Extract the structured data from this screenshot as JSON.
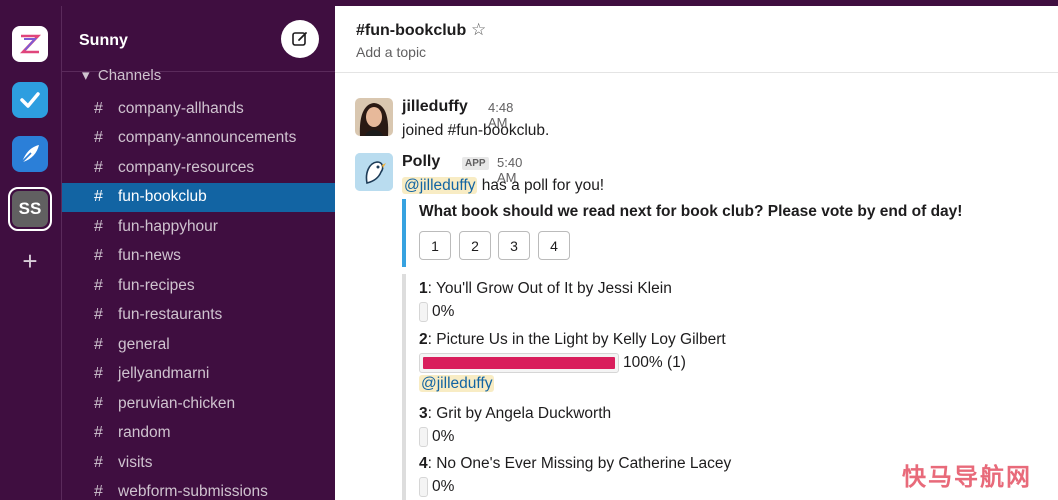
{
  "workspace": {
    "name": "Sunny",
    "current_initials": "SS"
  },
  "rail": {
    "apps": [
      "zoho-icon",
      "tasks-check-icon",
      "quill-icon"
    ]
  },
  "sidebar": {
    "section_label": "Channels",
    "channels": [
      {
        "label": "company-allhands",
        "active": false
      },
      {
        "label": "company-announcements",
        "active": false
      },
      {
        "label": "company-resources",
        "active": false
      },
      {
        "label": "fun-bookclub",
        "active": true
      },
      {
        "label": "fun-happyhour",
        "active": false
      },
      {
        "label": "fun-news",
        "active": false
      },
      {
        "label": "fun-recipes",
        "active": false
      },
      {
        "label": "fun-restaurants",
        "active": false
      },
      {
        "label": "general",
        "active": false
      },
      {
        "label": "jellyandmarni",
        "active": false
      },
      {
        "label": "peruvian-chicken",
        "active": false
      },
      {
        "label": "random",
        "active": false
      },
      {
        "label": "visits",
        "active": false
      },
      {
        "label": "webform-submissions",
        "active": false
      }
    ]
  },
  "channel": {
    "title": "#fun-bookclub",
    "topic_placeholder": "Add a topic"
  },
  "messages": {
    "m1": {
      "sender": "jilleduffy",
      "time": "4:48 AM",
      "text": "joined #fun-bookclub."
    },
    "m2": {
      "sender": "Polly",
      "badge": "APP",
      "time": "5:40 AM",
      "mention": "@jilleduffy",
      "text": "has a poll for you!",
      "question": "What book should we read next for book club? Please vote by end of day!",
      "buttons": [
        "1",
        "2",
        "3",
        "4"
      ],
      "options": [
        {
          "num": "1",
          "title": ": You'll Grow Out of It by Jessi Klein",
          "pct_text": "0%",
          "fill": 0
        },
        {
          "num": "2",
          "title": ": Picture Us in the Light by Kelly Loy Gilbert",
          "pct_text": "100% (1)",
          "fill": 1,
          "voter": "@jilleduffy"
        },
        {
          "num": "3",
          "title": ": Grit by Angela Duckworth",
          "pct_text": "0%",
          "fill": 0
        },
        {
          "num": "4",
          "title": ": No One's Ever Missing by Catherine Lacey",
          "pct_text": "0%",
          "fill": 0
        }
      ]
    }
  },
  "colors": {
    "sidebar_bg": "#3f0e40",
    "active_channel": "#1264a3",
    "poll_accent": "#36a2e0",
    "bar_fill": "#d91e5c"
  },
  "watermark": "快马导航网"
}
